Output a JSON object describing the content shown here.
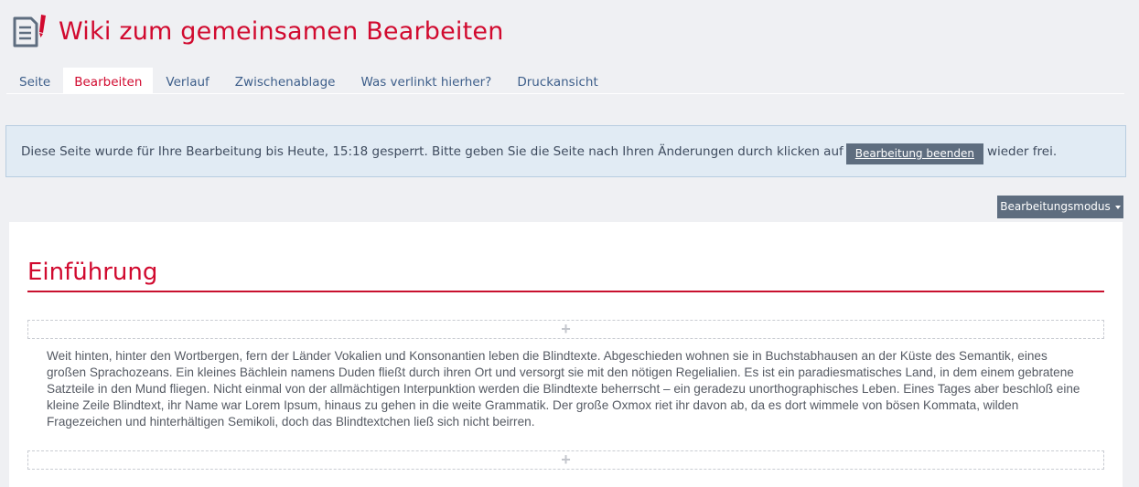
{
  "header": {
    "title": "Wiki zum gemeinsamen Bearbeiten",
    "icon": "wiki-edit-icon"
  },
  "tabs": [
    {
      "label": "Seite",
      "active": false
    },
    {
      "label": "Bearbeiten",
      "active": true
    },
    {
      "label": "Verlauf",
      "active": false
    },
    {
      "label": "Zwischenablage",
      "active": false
    },
    {
      "label": "Was verlinkt hierher?",
      "active": false
    },
    {
      "label": "Druckansicht",
      "active": false
    }
  ],
  "notice": {
    "text_before": "Diese Seite wurde für Ihre Bearbeitung bis Heute, 15:18 gesperrt. Bitte geben Sie die Seite nach Ihren Änderungen durch klicken auf",
    "button_label": "Bearbeitung beenden",
    "text_after": "wieder frei."
  },
  "mode_button": {
    "label": "Bearbeitungsmodus"
  },
  "content": {
    "section_title": "Einführung",
    "add_symbol": "+",
    "paragraph": "Weit hinten, hinter den Wortbergen, fern der Länder Vokalien und Konsonantien leben die Blindtexte. Abgeschieden wohnen sie in Buchstabhausen an der Küste des Semantik, eines großen Sprachozeans. Ein kleines Bächlein namens Duden fließt durch ihren Ort und versorgt sie mit den nötigen Regelialien. Es ist ein paradiesmatisches Land, in dem einem gebratene Satzteile in den Mund fliegen. Nicht einmal von der allmächtigen Interpunktion werden die Blindtexte beherrscht – ein geradezu unorthographisches Leben. Eines Tages aber beschloß eine kleine Zeile Blindtext, ihr Name war Lorem Ipsum, hinaus zu gehen in die weite Grammatik. Der große Oxmox riet ihr davon ab, da es dort wimmele von bösen Kommata, wilden Fragezeichen und hinterhältigen Semikoli, doch das Blindtextchen ließ sich nicht beirren."
  },
  "colors": {
    "accent": "#d10a2f",
    "link": "#3d5e8a",
    "button": "#5e6d7f",
    "notice_bg": "#e1ebf4"
  }
}
